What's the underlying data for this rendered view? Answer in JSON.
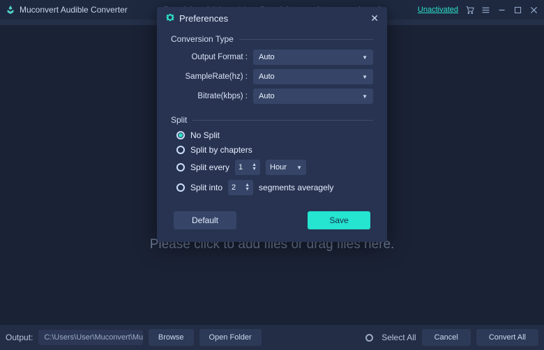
{
  "titlebar": {
    "app_name": "Muconvert Audible Converter",
    "trial_days_label": "Remaining trial days:",
    "trial_days_value": "14",
    "conversions_label": "Remaining complete conversions:",
    "conversions_value": "2",
    "unactivated": "Unactivated"
  },
  "modal": {
    "title": "Preferences",
    "section_conversion": "Conversion Type",
    "label_output_format": "Output Format :",
    "value_output_format": "Auto",
    "label_samplerate": "SampleRate(hz) :",
    "value_samplerate": "Auto",
    "label_bitrate": "Bitrate(kbps) :",
    "value_bitrate": "Auto",
    "section_split": "Split",
    "opt_no_split": "No Split",
    "opt_chapters": "Split by chapters",
    "opt_every": "Split every",
    "opt_every_value": "1",
    "opt_every_unit": "Hour",
    "opt_into": "Split into",
    "opt_into_value": "2",
    "opt_into_suffix": "segments averagely",
    "btn_default": "Default",
    "btn_save": "Save"
  },
  "main": {
    "hint": "Please click to add files or drag files here."
  },
  "bottom": {
    "output_label": "Output:",
    "output_path": "C:\\Users\\User\\Muconvert\\Muconvert Audib...",
    "browse": "Browse",
    "open_folder": "Open Folder",
    "select_all": "Select All",
    "cancel": "Cancel",
    "convert_all": "Convert All"
  }
}
